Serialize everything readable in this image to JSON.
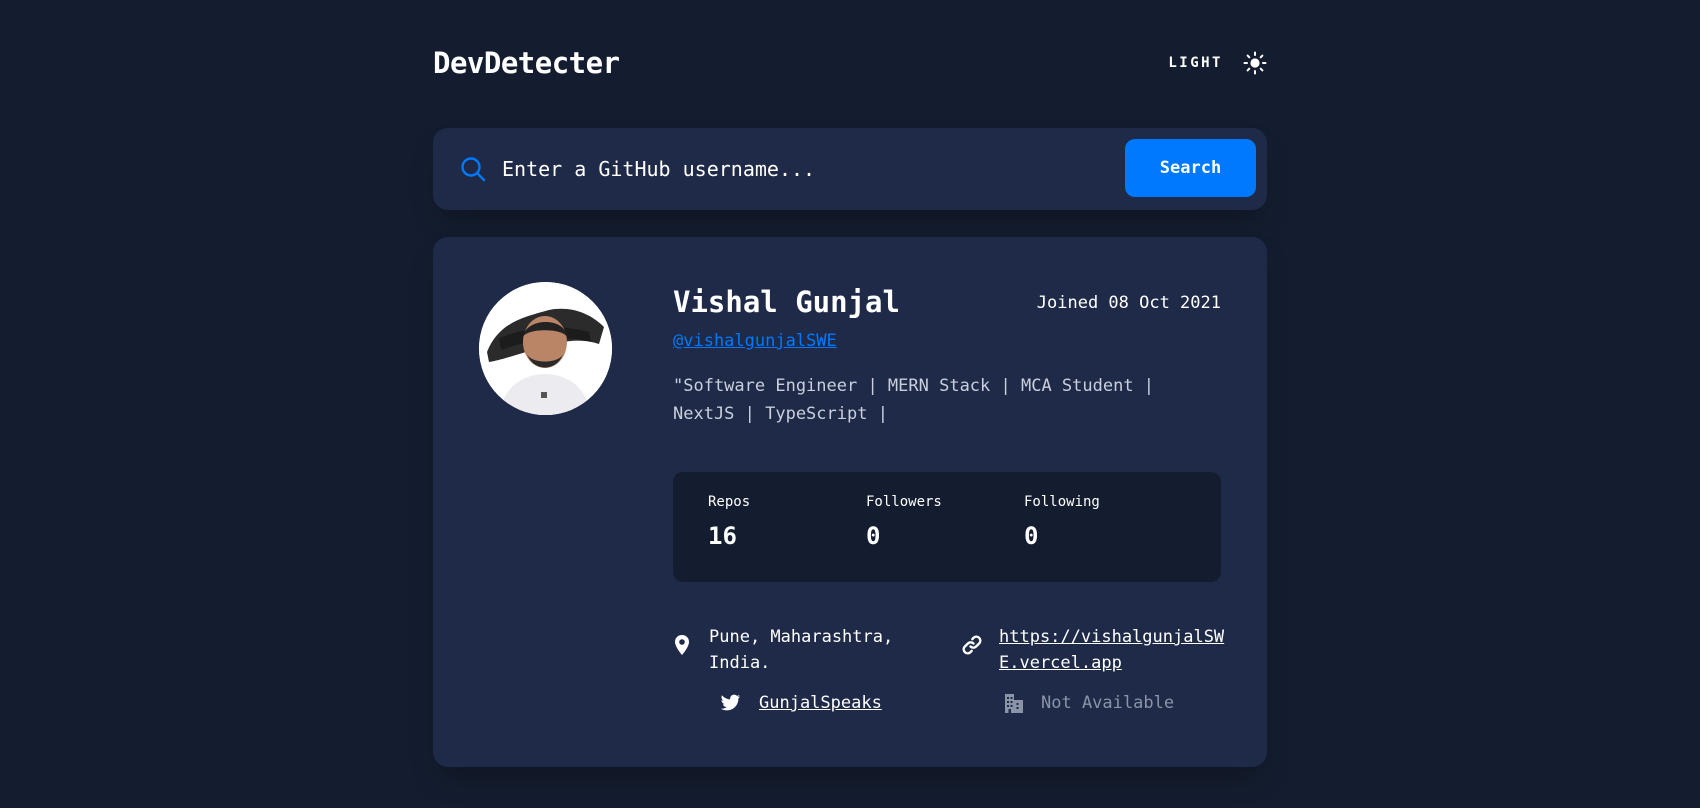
{
  "app": {
    "title": "DevDetecter",
    "theme_toggle_label": "LIGHT",
    "theme_icon": "sun-icon"
  },
  "search": {
    "placeholder": "Enter a GitHub username...",
    "value": "",
    "button_label": "Search",
    "icon": "search-icon"
  },
  "profile": {
    "avatar_icon": "avatar-photo",
    "name": "Vishal Gunjal",
    "joined": "Joined 08 Oct 2021",
    "login": "@vishalgunjalSWE",
    "bio": "\"Software Engineer | MERN Stack | MCA Student | NextJS | TypeScript |",
    "stats": [
      {
        "label": "Repos",
        "value": "16"
      },
      {
        "label": "Followers",
        "value": "0"
      },
      {
        "label": "Following",
        "value": "0"
      }
    ],
    "location": {
      "icon": "location-pin-icon",
      "text": "Pune, Maharashtra, India."
    },
    "website": {
      "icon": "link-icon",
      "text": "https://vishalgunjalSWE.vercel.app"
    },
    "twitter": {
      "icon": "twitter-icon",
      "text": "GunjalSpeaks"
    },
    "company": {
      "icon": "building-icon",
      "text": "Not Available"
    }
  },
  "colors": {
    "background": "#141d2f",
    "card": "#1e2a47",
    "accent": "#0079ff",
    "muted": "#8b93a7"
  }
}
